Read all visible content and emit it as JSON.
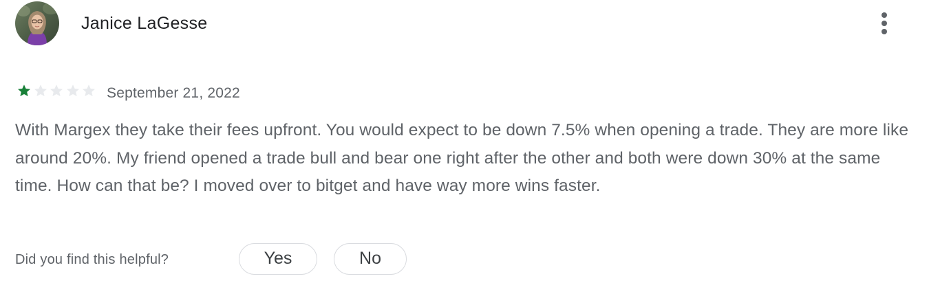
{
  "review": {
    "author": "Janice LaGesse",
    "avatar_icon": "user-avatar-photo",
    "more_icon": "more-vert-icon",
    "rating": 1,
    "rating_max": 5,
    "date": "September 21, 2022",
    "text": "With Margex they take their fees upfront. You would expect to be down 7.5% when opening a trade. They are more like around 20%. My friend opened a trade bull and bear one right after the other and both were down 30% at the same time. How can that be? I moved over to bitget and have way more wins faster."
  },
  "helpful": {
    "question": "Did you find this helpful?",
    "yes_label": "Yes",
    "no_label": "No"
  },
  "colors": {
    "star_filled": "#188038",
    "star_empty": "#e8eaed",
    "secondary_text": "#5f6368",
    "primary_text": "#202124",
    "button_border": "#dadce0"
  }
}
